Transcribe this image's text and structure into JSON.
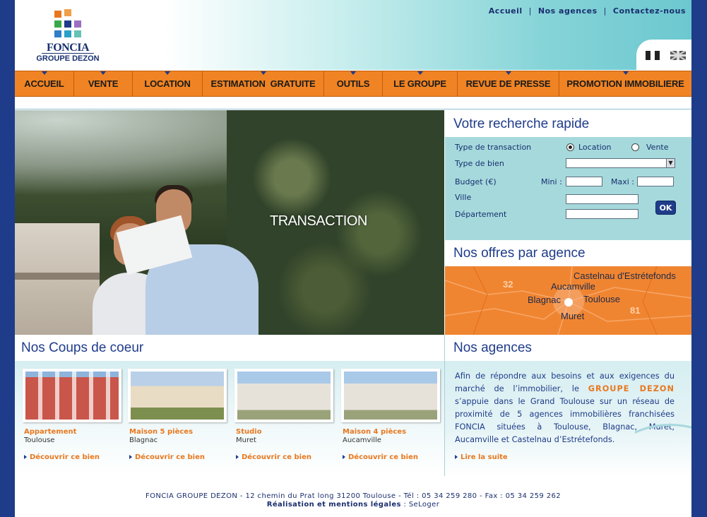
{
  "header": {
    "logo": {
      "name": "FONCIA",
      "sub": "GROUPE DEZON"
    },
    "top_links": [
      "Accueil",
      "Nos agences",
      "Contactez-nous"
    ],
    "languages": [
      "fr-flag-icon",
      "uk-flag-icon"
    ]
  },
  "nav": {
    "items": [
      {
        "label": "ACCUEIL"
      },
      {
        "label": "VENTE"
      },
      {
        "label": "LOCATION"
      },
      {
        "label": "ESTIMATION  GRATUITE"
      },
      {
        "label": "OUTILS"
      },
      {
        "label": "LE GROUPE"
      },
      {
        "label": "REVUE DE PRESSE"
      },
      {
        "label": "PROMOTION IMMOBILIERE"
      }
    ]
  },
  "hero": {
    "title": "TRANSACTION"
  },
  "search": {
    "title": "Votre recherche rapide",
    "transaction_label": "Type de transaction",
    "opt_location": "Location",
    "opt_vente": "Vente",
    "selected": "Location",
    "type_bien_label": "Type de bien",
    "type_bien_value": "",
    "budget_label": "Budget (€)",
    "mini_label": "Mini :",
    "maxi_label": "Maxi :",
    "ville_label": "Ville",
    "departement_label": "Département",
    "ok_label": "OK"
  },
  "offres": {
    "title": "Nos offres par agence",
    "cities": [
      "Castelnau d'Estrétefonds",
      "Aucamville",
      "Blagnac",
      "Toulouse",
      "Muret"
    ],
    "departments": [
      "32",
      "81"
    ]
  },
  "coups": {
    "title": "Nos Coups de coeur",
    "items": [
      {
        "type": "Appartement",
        "city": "Toulouse",
        "link": "Découvrir ce bien"
      },
      {
        "type": "Maison 5 pièces",
        "city": "Blagnac",
        "link": "Découvrir ce bien"
      },
      {
        "type": "Studio",
        "city": "Muret",
        "link": "Découvrir ce bien"
      },
      {
        "type": "Maison 4 pièces",
        "city": "Aucamville",
        "link": "Découvrir ce bien"
      }
    ]
  },
  "agences": {
    "title": "Nos agences",
    "text_before": "Afin de répondre aux besoins et aux exigences du marché de l’immobilier, le ",
    "highlight": "GROUPE DEZON",
    "text_after": " s’appuie dans le Grand Toulouse sur un réseau de proximité de 5 agences immobilières franchisées FONCIA situées à Toulouse, Blagnac, Muret, Aucamville et Castelnau d’Estrétefonds.",
    "more_link": "Lire la suite"
  },
  "footer": {
    "line1": "FONCIA GROUPE DEZON - 12 chemin du Prat long 31200 Toulouse - Tél : 05 34 259 280 - Fax : 05 34 259 262",
    "credits_label": "Réalisation et mentions légales",
    "credits_sep": " : ",
    "credits_value": "SeLoger"
  }
}
